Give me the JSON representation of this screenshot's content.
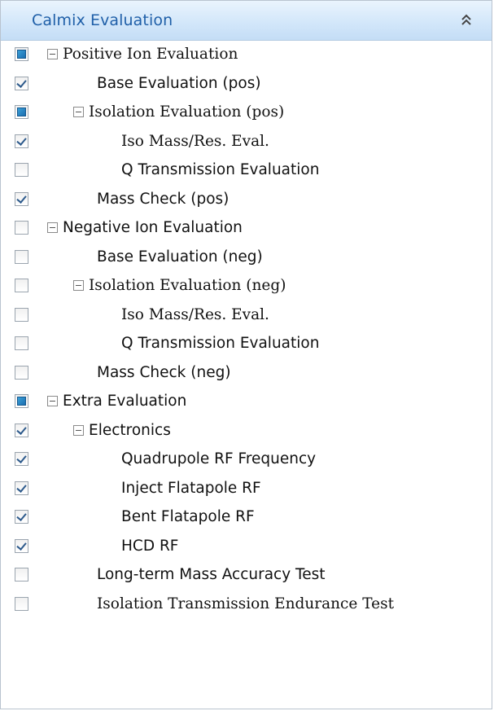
{
  "panel": {
    "title": "Calmix Evaluation",
    "collapse_icon": "double-chevron-up-icon"
  },
  "colors": {
    "header_text": "#1f5fa8",
    "header_bg": "#d3e7fa",
    "partial_fill": "#1b6eb0"
  },
  "tree": {
    "items": [
      {
        "label": "Positive Ion Evaluation",
        "state": "partial",
        "expandable": true
      },
      {
        "label": "Base Evaluation (pos)",
        "state": "checked",
        "expandable": false
      },
      {
        "label": "Isolation Evaluation (pos)",
        "state": "partial",
        "expandable": true
      },
      {
        "label": "Iso Mass/Res. Eval.",
        "state": "checked",
        "expandable": false
      },
      {
        "label": "Q Transmission Evaluation",
        "state": "unchecked",
        "expandable": false
      },
      {
        "label": "Mass Check (pos)",
        "state": "checked",
        "expandable": false
      },
      {
        "label": "Negative Ion Evaluation",
        "state": "unchecked",
        "expandable": true
      },
      {
        "label": "Base Evaluation (neg)",
        "state": "unchecked",
        "expandable": false
      },
      {
        "label": "Isolation Evaluation (neg)",
        "state": "unchecked",
        "expandable": true
      },
      {
        "label": "Iso Mass/Res. Eval.",
        "state": "unchecked",
        "expandable": false
      },
      {
        "label": "Q Transmission Evaluation",
        "state": "unchecked",
        "expandable": false
      },
      {
        "label": "Mass Check (neg)",
        "state": "unchecked",
        "expandable": false
      },
      {
        "label": "Extra Evaluation",
        "state": "partial",
        "expandable": true
      },
      {
        "label": "Electronics",
        "state": "checked",
        "expandable": true
      },
      {
        "label": "Quadrupole RF Frequency",
        "state": "checked",
        "expandable": false
      },
      {
        "label": "Inject Flatapole RF",
        "state": "checked",
        "expandable": false
      },
      {
        "label": "Bent Flatapole RF",
        "state": "checked",
        "expandable": false
      },
      {
        "label": "HCD RF",
        "state": "checked",
        "expandable": false
      },
      {
        "label": "Long-term Mass Accuracy Test",
        "state": "unchecked",
        "expandable": false
      },
      {
        "label": "Isolation Transmission Endurance Test",
        "state": "unchecked",
        "expandable": false
      }
    ]
  }
}
